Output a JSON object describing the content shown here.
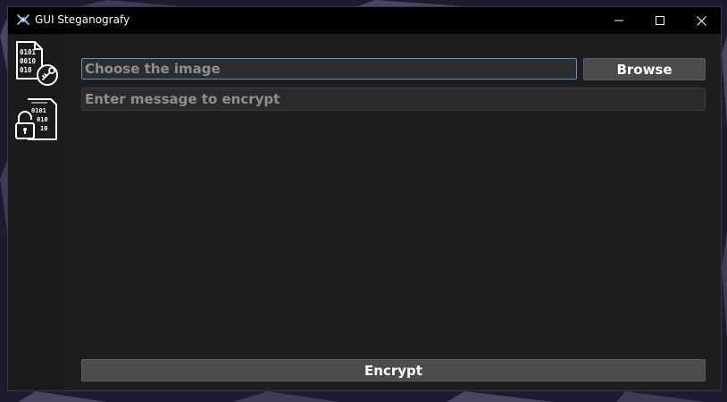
{
  "window": {
    "title": "GUI Steganografy"
  },
  "sidebar": {
    "items": [
      {
        "name": "encrypt",
        "icon": "binary-document-key-icon"
      },
      {
        "name": "decrypt",
        "icon": "binary-document-lock-icon"
      }
    ]
  },
  "main": {
    "image_input": {
      "placeholder": "Choose the image",
      "value": ""
    },
    "browse_label": "Browse",
    "message_input": {
      "placeholder": "Enter message to encrypt",
      "value": ""
    },
    "encrypt_label": "Encrypt"
  },
  "colors": {
    "titlebar": "#000000",
    "window_bg": "#1e1e1e",
    "sidebar_bg": "#1b1b1b",
    "field_bg": "#2b2b2b",
    "button_bg": "#4c4c4c",
    "focus_border": "#4f93d9",
    "desktop_bg": "#1d1b2e"
  }
}
